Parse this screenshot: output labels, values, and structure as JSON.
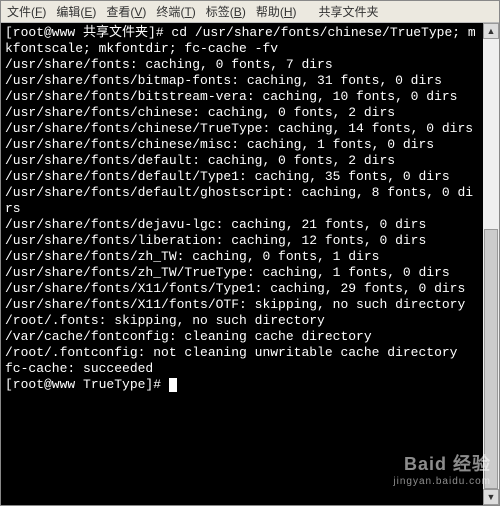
{
  "menubar": {
    "items": [
      {
        "label": "文件",
        "key": "F"
      },
      {
        "label": "编辑",
        "key": "E"
      },
      {
        "label": "查看",
        "key": "V"
      },
      {
        "label": "终端",
        "key": "T"
      },
      {
        "label": "标签",
        "key": "B"
      },
      {
        "label": "帮助",
        "key": "H"
      }
    ],
    "title_box": "共享文件夹"
  },
  "terminal": {
    "lines": [
      "[root@www 共享文件夹]# cd /usr/share/fonts/chinese/TrueType; mkfontscale; mkfontdir; fc-cache -fv",
      "/usr/share/fonts: caching, 0 fonts, 7 dirs",
      "/usr/share/fonts/bitmap-fonts: caching, 31 fonts, 0 dirs",
      "/usr/share/fonts/bitstream-vera: caching, 10 fonts, 0 dirs",
      "/usr/share/fonts/chinese: caching, 0 fonts, 2 dirs",
      "/usr/share/fonts/chinese/TrueType: caching, 14 fonts, 0 dirs",
      "/usr/share/fonts/chinese/misc: caching, 1 fonts, 0 dirs",
      "/usr/share/fonts/default: caching, 0 fonts, 2 dirs",
      "/usr/share/fonts/default/Type1: caching, 35 fonts, 0 dirs",
      "/usr/share/fonts/default/ghostscript: caching, 8 fonts, 0 dirs",
      "/usr/share/fonts/dejavu-lgc: caching, 21 fonts, 0 dirs",
      "/usr/share/fonts/liberation: caching, 12 fonts, 0 dirs",
      "/usr/share/fonts/zh_TW: caching, 0 fonts, 1 dirs",
      "/usr/share/fonts/zh_TW/TrueType: caching, 1 fonts, 0 dirs",
      "/usr/share/fonts/X11/fonts/Type1: caching, 29 fonts, 0 dirs",
      "/usr/share/fonts/X11/fonts/OTF: skipping, no such directory",
      "/root/.fonts: skipping, no such directory",
      "/var/cache/fontconfig: cleaning cache directory",
      "/root/.fontconfig: not cleaning unwritable cache directory",
      "fc-cache: succeeded",
      "[root@www TrueType]# "
    ]
  },
  "watermark": {
    "big": "Baid 经验",
    "small": "jingyan.baidu.com"
  }
}
